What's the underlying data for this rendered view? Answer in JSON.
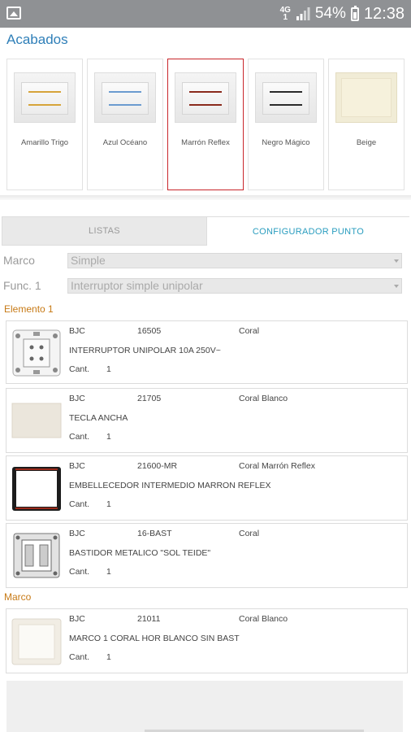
{
  "status_bar": {
    "network": "4G",
    "network_sub": "1",
    "battery": "54%",
    "time": "12:38",
    "icons": [
      "gallery-icon",
      "signal-icon",
      "battery-icon"
    ]
  },
  "acabados": {
    "title": "Acabados",
    "selected": "Marrón Reflex",
    "finishes": [
      {
        "label": "Amarillo Trigo",
        "trim_color": "#d6a43a"
      },
      {
        "label": "Azul Océano",
        "trim_color": "#6b9bd0"
      },
      {
        "label": "Marrón Reflex",
        "trim_color": "#8a2a1c"
      },
      {
        "label": "Negro Mágico",
        "trim_color": "#2a2a2a"
      },
      {
        "label": "Beige",
        "trim_color": "#efe9d2"
      }
    ]
  },
  "tabs": {
    "listas": "LISTAS",
    "configurador": "CONFIGURADOR PUNTO",
    "active": "CONFIGURADOR PUNTO"
  },
  "form": {
    "marco_label": "Marco",
    "marco_value": "Simple",
    "func_label": "Func. 1",
    "func_value": "Interruptor simple unipolar"
  },
  "sections": {
    "elemento": "Elemento 1",
    "marco": "Marco"
  },
  "items": [
    {
      "brand": "BJC",
      "code": "16505",
      "line": "Coral",
      "desc": "INTERRUPTOR UNIPOLAR 10A 250V~",
      "cant_label": "Cant.",
      "qty": "1",
      "thumb": "mechanism-icon"
    },
    {
      "brand": "BJC",
      "code": "21705",
      "line": "Coral Blanco",
      "desc": "TECLA ANCHA",
      "cant_label": "Cant.",
      "qty": "1",
      "thumb": "rocker-key-icon"
    },
    {
      "brand": "BJC",
      "code": "21600-MR",
      "line": "Coral Marrón Reflex",
      "desc": "EMBELLECEDOR INTERMEDIO MARRON REFLEX",
      "cant_label": "Cant.",
      "qty": "1",
      "thumb": "trim-frame-icon"
    },
    {
      "brand": "BJC",
      "code": "16-BAST",
      "line": "Coral",
      "desc": "BASTIDOR METALICO \"SOL TEIDE\"",
      "cant_label": "Cant.",
      "qty": "1",
      "thumb": "metal-frame-icon"
    },
    {
      "brand": "BJC",
      "code": "21011",
      "line": "Coral Blanco",
      "desc": "MARCO 1 CORAL HOR BLANCO SIN BAST",
      "cant_label": "Cant.",
      "qty": "1",
      "thumb": "cover-frame-icon"
    }
  ],
  "colors": {
    "accent_blue": "#2f7fb8",
    "tab_active": "#2a9dbf",
    "section_orange": "#c77a16",
    "selected_border": "#c8262b",
    "status_bar": "#8f9194"
  }
}
